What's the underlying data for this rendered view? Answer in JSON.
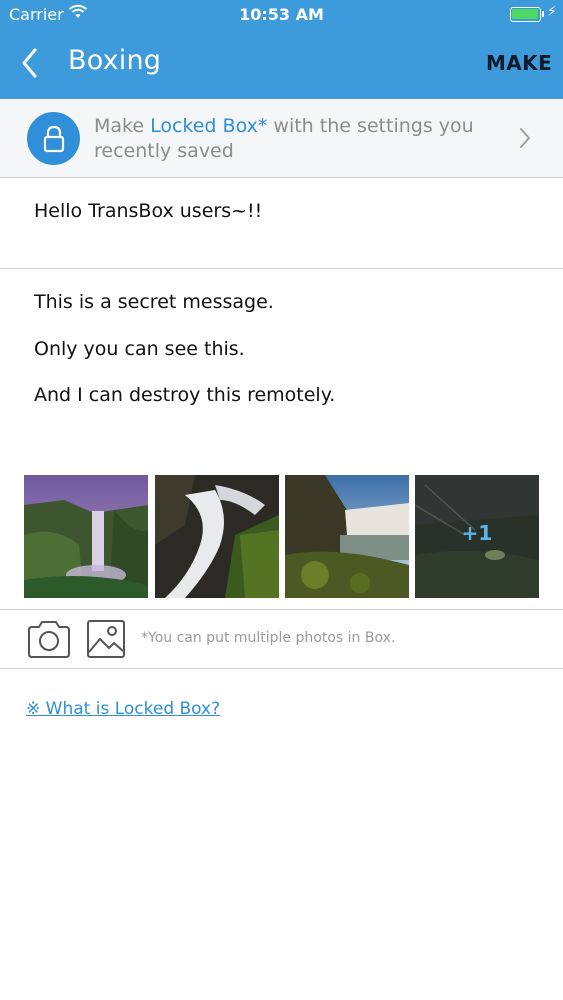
{
  "status_bar": {
    "carrier": "Carrier",
    "time": "10:53 AM",
    "battery_color": "#4cd964"
  },
  "header": {
    "title": "Boxing",
    "make_label": "MAKE",
    "bar_color": "#3d9bdc"
  },
  "saved_settings": {
    "prefix": "Make ",
    "highlight": "Locked Box*",
    "suffix_line1": " with the settings you",
    "line2": "recently saved",
    "accent_color": "#2f8fd8"
  },
  "message": {
    "title": "Hello TransBox users~!!",
    "lines": [
      "This is a secret message.",
      "Only you can see this.",
      "And I can destroy this remotely."
    ]
  },
  "photos": {
    "extra_count_label": "+1",
    "items": [
      "waterfall-photo-1",
      "waterfall-photo-2",
      "waterfall-photo-3",
      "waterfall-photo-4"
    ]
  },
  "attach": {
    "hint": "*You can put multiple photos in Box."
  },
  "help_link": "※ What is Locked Box?"
}
